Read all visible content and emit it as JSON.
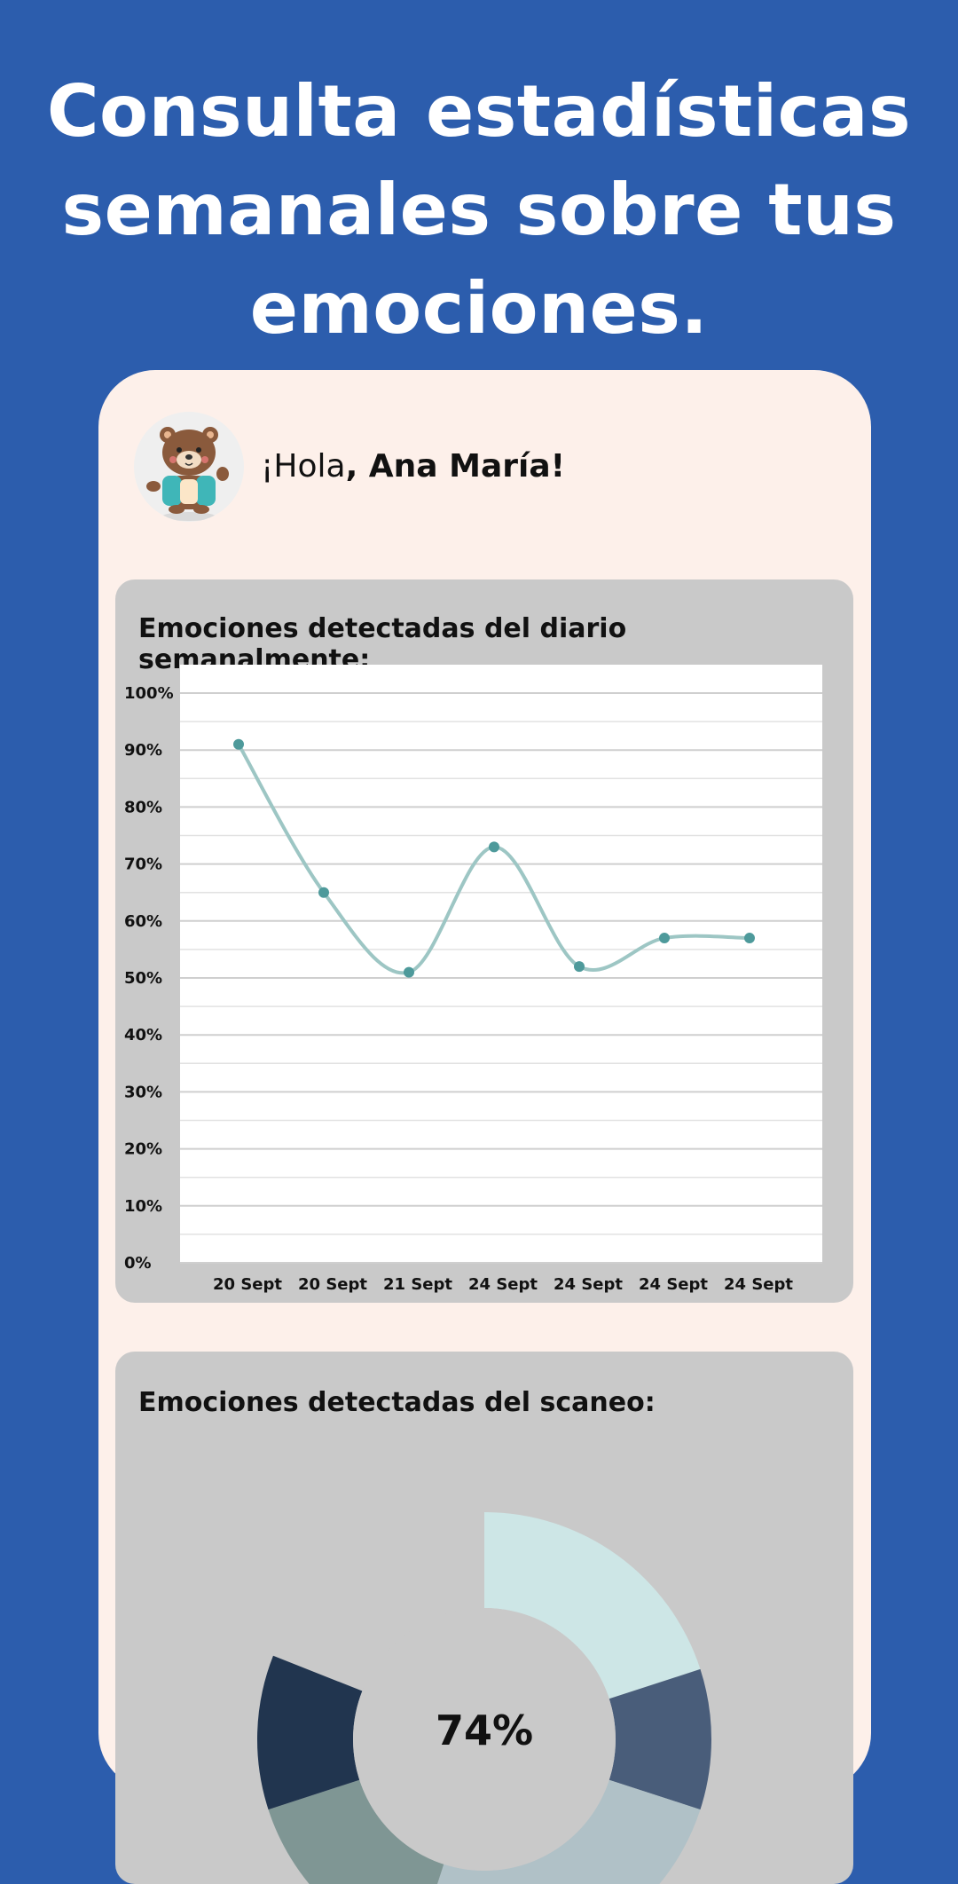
{
  "headline": {
    "line1": "Consulta estadísticas",
    "line2": "semanales sobre tus",
    "line3": "emociones."
  },
  "greeting": {
    "prefix": "¡Hola",
    "name": ", Ana María!"
  },
  "avatar": {
    "icon": "bear-mascot-icon"
  },
  "line_card": {
    "title": "Emociones detectadas del diario semanalmente:"
  },
  "donut_card": {
    "title": "Emociones detectadas del scaneo:",
    "center_value": "74%"
  },
  "chart_data": [
    {
      "type": "line",
      "title": "Emociones detectadas del diario semanalmente:",
      "x": [
        "20 Sept",
        "20 Sept",
        "21 Sept",
        "24 Sept",
        "24 Sept",
        "24 Sept",
        "24 Sept"
      ],
      "values": [
        91,
        65,
        51,
        73,
        52,
        57,
        57
      ],
      "ylim": [
        0,
        100
      ],
      "yticks": [
        "0%",
        "10%",
        "20%",
        "30%",
        "40%",
        "50%",
        "60%",
        "70%",
        "80%",
        "90%",
        "100%"
      ],
      "grid": true,
      "colors": {
        "line": "#9DC6C4",
        "point": "#4E9A9B"
      }
    },
    {
      "type": "pie",
      "title": "Emociones detectadas del scaneo:",
      "center_label": "74%",
      "values": [
        0.2,
        0.1,
        0.25,
        0.15,
        0.11
      ],
      "colors": [
        "#CDE6E6",
        "#495D7A",
        "#B0C1C7",
        "#7F9694",
        "#21354F"
      ]
    }
  ]
}
